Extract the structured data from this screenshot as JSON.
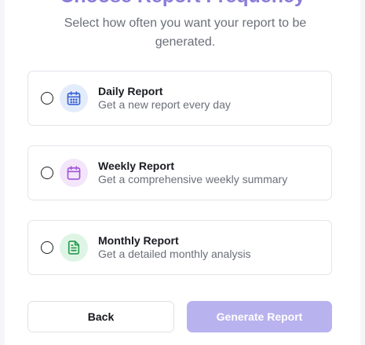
{
  "header": {
    "title": "Choose Report Frequency",
    "subtitle": "Select how often you want your report to be generated."
  },
  "options": [
    {
      "title": "Daily Report",
      "description": "Get a new report every day",
      "icon": "calendar-icon",
      "icon_color": "#3b63d6",
      "icon_bg": "#e3ecfb",
      "selected": false
    },
    {
      "title": "Weekly Report",
      "description": "Get a comprehensive weekly summary",
      "icon": "calendar-icon",
      "icon_color": "#a155d8",
      "icon_bg": "#f3e6fb",
      "selected": false
    },
    {
      "title": "Monthly Report",
      "description": "Get a detailed monthly analysis",
      "icon": "document-icon",
      "icon_color": "#2a9a4f",
      "icon_bg": "#def5e6",
      "selected": false
    }
  ],
  "actions": {
    "back_label": "Back",
    "generate_label": "Generate Report",
    "generate_enabled": false
  },
  "colors": {
    "accent": "#8c7ad9",
    "button_disabled": "#b8b2ef"
  }
}
